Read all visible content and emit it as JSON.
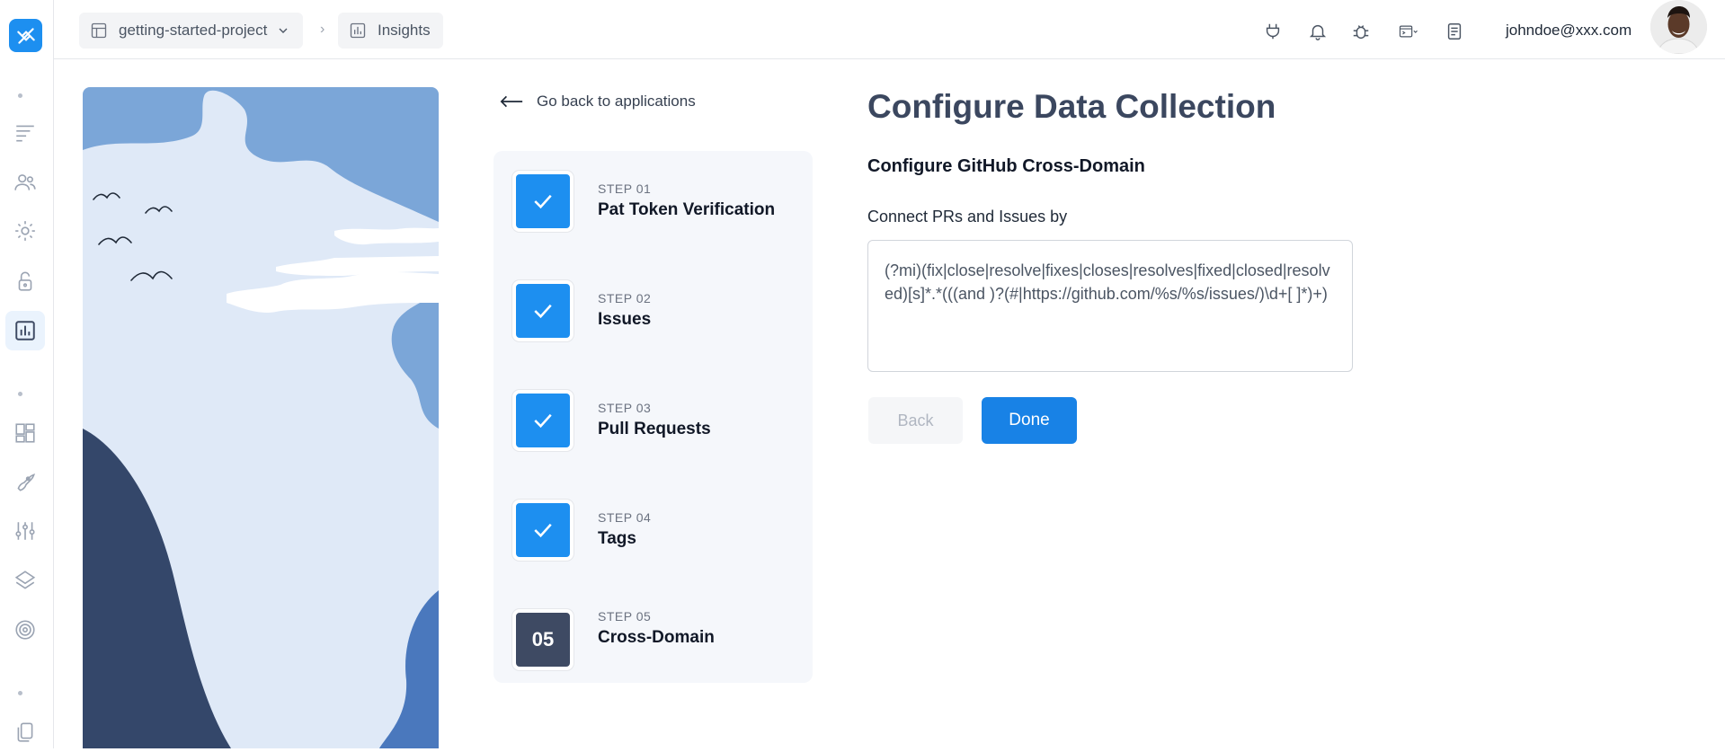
{
  "breadcrumb": {
    "project": "getting-started-project",
    "section": "Insights"
  },
  "user": {
    "email": "johndoe@xxx.com"
  },
  "back_link": "Go back to applications",
  "steps": [
    {
      "sub": "STEP 01",
      "title": "Pat Token Verification",
      "state": "done"
    },
    {
      "sub": "STEP 02",
      "title": "Issues",
      "state": "done"
    },
    {
      "sub": "STEP 03",
      "title": "Pull Requests",
      "state": "done"
    },
    {
      "sub": "STEP 04",
      "title": "Tags",
      "state": "done"
    },
    {
      "sub": "STEP 05",
      "title": "Cross-Domain",
      "state": "current",
      "number": "05"
    }
  ],
  "main": {
    "title": "Configure Data Collection",
    "section_title": "Configure GitHub Cross-Domain",
    "field_label": "Connect PRs and Issues by",
    "regex_value": "(?mi)(fix|close|resolve|fixes|closes|resolves|fixed|closed|resolved)[s]*.*(((and )?(#|https://github.com/%s/%s/issues/)\\d+[ ]*)+)",
    "back_button": "Back",
    "done_button": "Done"
  },
  "colors": {
    "accent": "#1882e6",
    "step_done": "#1d8ff0",
    "step_current": "#3e4a63",
    "title": "#3b475f"
  },
  "icons": {
    "rail": [
      "logo-icon",
      "list-icon",
      "users-icon",
      "settings-icon",
      "lock-icon",
      "insights-icon",
      "dashboard-icon",
      "rocket-icon",
      "sliders-icon",
      "layers-icon",
      "target-icon",
      "documents-icon"
    ],
    "topbar": [
      "plug-icon",
      "bell-icon",
      "bug-icon",
      "terminal-icon",
      "notes-icon"
    ]
  }
}
